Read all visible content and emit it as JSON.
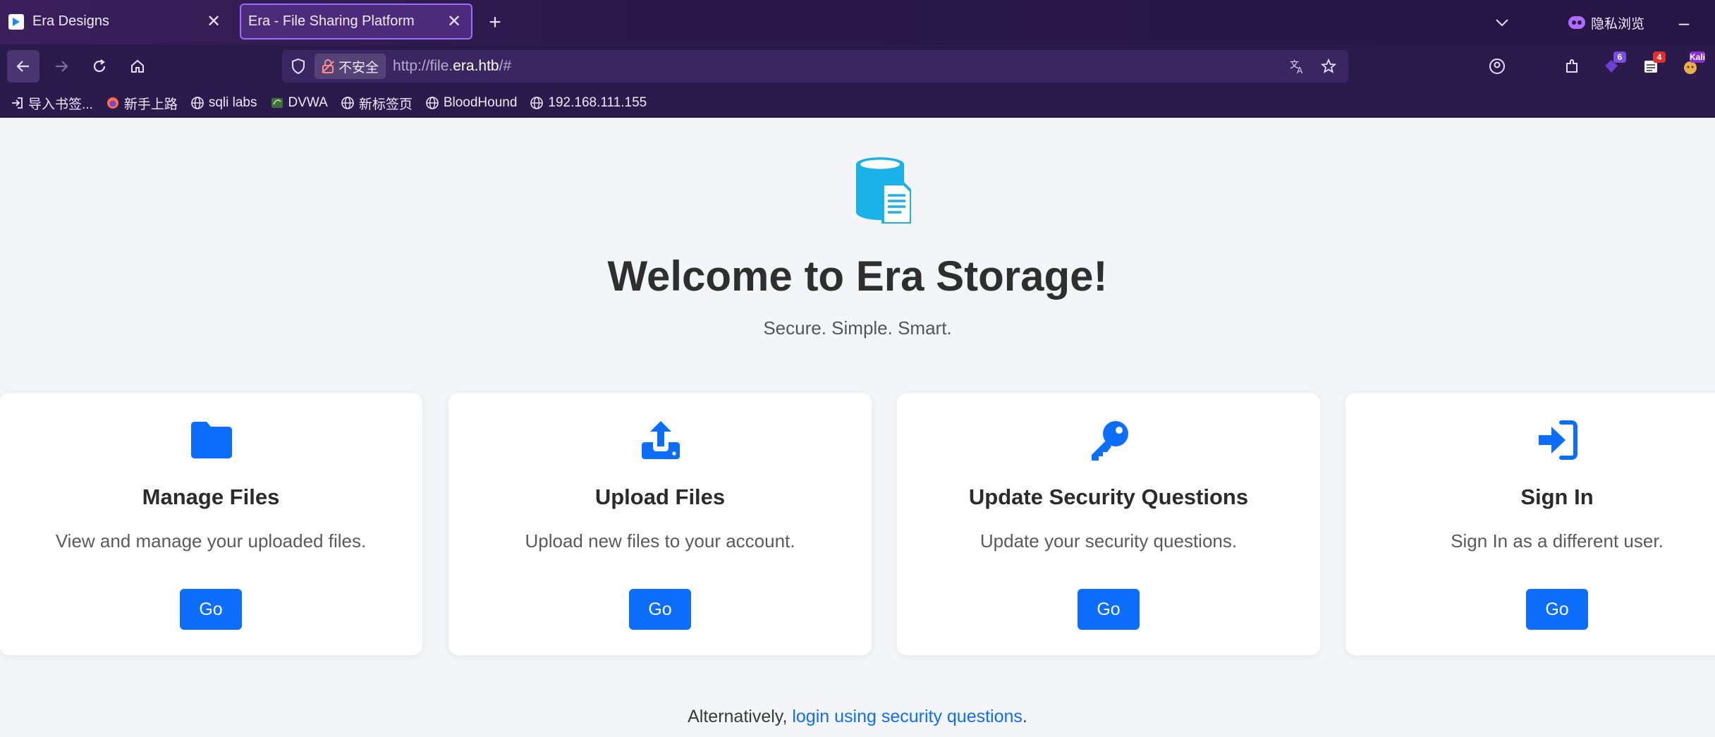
{
  "browser": {
    "tabs": [
      {
        "title": "Era Designs",
        "active": false
      },
      {
        "title": "Era - File Sharing Platform",
        "active": true
      }
    ],
    "private_label": "隐私浏览",
    "url": {
      "insecure_label": "不安全",
      "prefix": "http://file.",
      "highlight": "era.htb",
      "suffix": "/#"
    },
    "badges": {
      "ext_count": "6",
      "mail_count": "4",
      "profile": "Kali"
    },
    "bookmarks": [
      "导入书签...",
      "新手上路",
      "sqli labs",
      "DVWA",
      "新标签页",
      "BloodHound",
      "192.168.111.155"
    ]
  },
  "page": {
    "title": "Welcome to Era Storage!",
    "subtitle": "Secure. Simple. Smart.",
    "cards": [
      {
        "title": "Manage Files",
        "desc": "View and manage your uploaded files.",
        "button": "Go",
        "icon": "folder-icon"
      },
      {
        "title": "Upload Files",
        "desc": "Upload new files to your account.",
        "button": "Go",
        "icon": "upload-icon"
      },
      {
        "title": "Update Security Questions",
        "desc": "Update your security questions.",
        "button": "Go",
        "icon": "key-icon"
      },
      {
        "title": "Sign In",
        "desc": "Sign In as a different user.",
        "button": "Go",
        "icon": "sign-in-icon"
      }
    ],
    "alt_prefix": "Alternatively, ",
    "alt_link": "login using security questions",
    "alt_suffix": "."
  },
  "colors": {
    "accent": "#0d6efd",
    "hero_icon": "#1ab2e8",
    "chrome": "#2b1a4c"
  }
}
